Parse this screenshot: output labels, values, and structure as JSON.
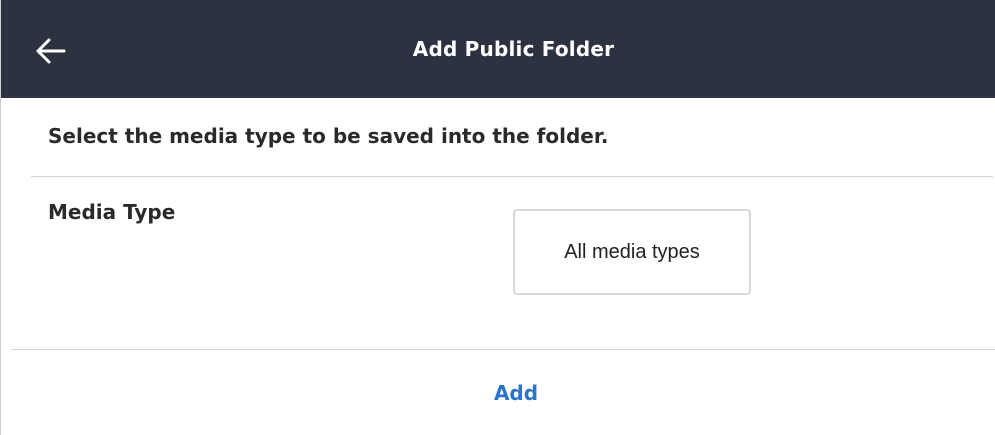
{
  "header": {
    "title": "Add Public Folder",
    "back_icon": "arrow-left-icon"
  },
  "content": {
    "instruction": "Select the media type to be saved into the folder.",
    "media_type_label": "Media Type",
    "media_type_value": "All media types"
  },
  "footer": {
    "add_label": "Add"
  },
  "colors": {
    "header_bg": "#2d3241",
    "header_text": "#ffffff",
    "body_text": "#2a2a2a",
    "accent": "#2b74c9",
    "divider": "#d4d4d4"
  }
}
